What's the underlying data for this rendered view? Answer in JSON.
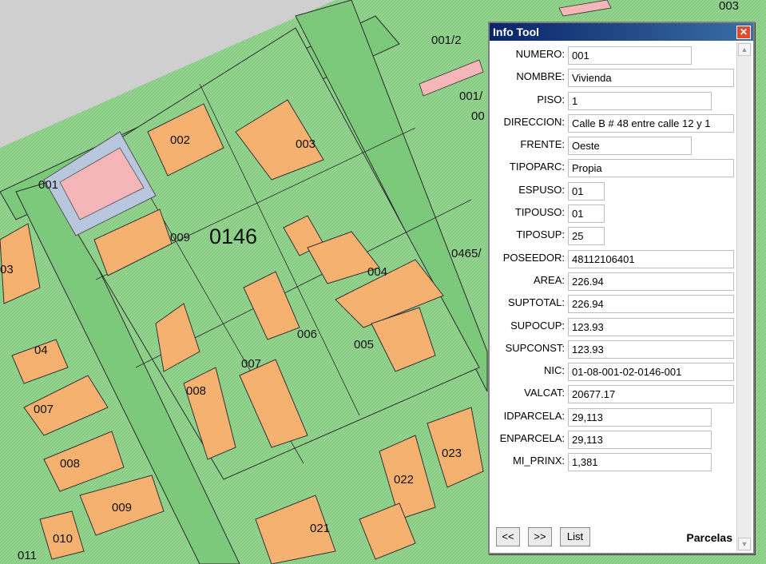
{
  "map": {
    "block_label": "0146",
    "parcel_labels": [
      "001/2",
      "001/",
      "00",
      "003",
      "001",
      "002",
      "003",
      "009",
      "004",
      "005",
      "006",
      "007",
      "008",
      "04",
      "007",
      "008",
      "009",
      "010",
      "011",
      "021",
      "022",
      "023",
      "0465/",
      "03",
      "004"
    ]
  },
  "info_tool": {
    "title": "Info Tool",
    "close_glyph": "✕",
    "fields": [
      {
        "label": "NUMERO:",
        "value": "001"
      },
      {
        "label": "NOMBRE:",
        "value": "Vivienda"
      },
      {
        "label": "PISO:",
        "value": "1"
      },
      {
        "label": "DIRECCION:",
        "value": "Calle B # 48 entre calle 12 y 1"
      },
      {
        "label": "FRENTE:",
        "value": "Oeste"
      },
      {
        "label": "TIPOPARC:",
        "value": "Propia"
      },
      {
        "label": "ESPUSO:",
        "value": "01"
      },
      {
        "label": "TIPOUSO:",
        "value": "01"
      },
      {
        "label": "TIPOSUP:",
        "value": "25"
      },
      {
        "label": "POSEEDOR:",
        "value": "48112106401"
      },
      {
        "label": "AREA:",
        "value": "226.94"
      },
      {
        "label": "SUPTOTAL:",
        "value": "226.94"
      },
      {
        "label": "SUPOCUP:",
        "value": "123.93"
      },
      {
        "label": "SUPCONST:",
        "value": "123.93"
      },
      {
        "label": "NIC:",
        "value": "01-08-001-02-0146-001"
      },
      {
        "label": "VALCAT:",
        "value": "20677.17"
      },
      {
        "label": "IDPARCELA:",
        "value": "29,113"
      },
      {
        "label": "ENPARCELA:",
        "value": "29,113"
      },
      {
        "label": "MI_PRINX:",
        "value": "1,381"
      }
    ],
    "buttons": {
      "prev": "<<",
      "next": ">>",
      "list": "List"
    },
    "layer_name": "Parcelas",
    "scroll_up": "▲",
    "scroll_down": "▼"
  },
  "colors": {
    "block_green": "#92d58f",
    "street_green": "#7dc97c",
    "building_orange": "#f5b170",
    "selected_pink": "#f4b6b8",
    "background_gray": "#cfcfcf"
  }
}
